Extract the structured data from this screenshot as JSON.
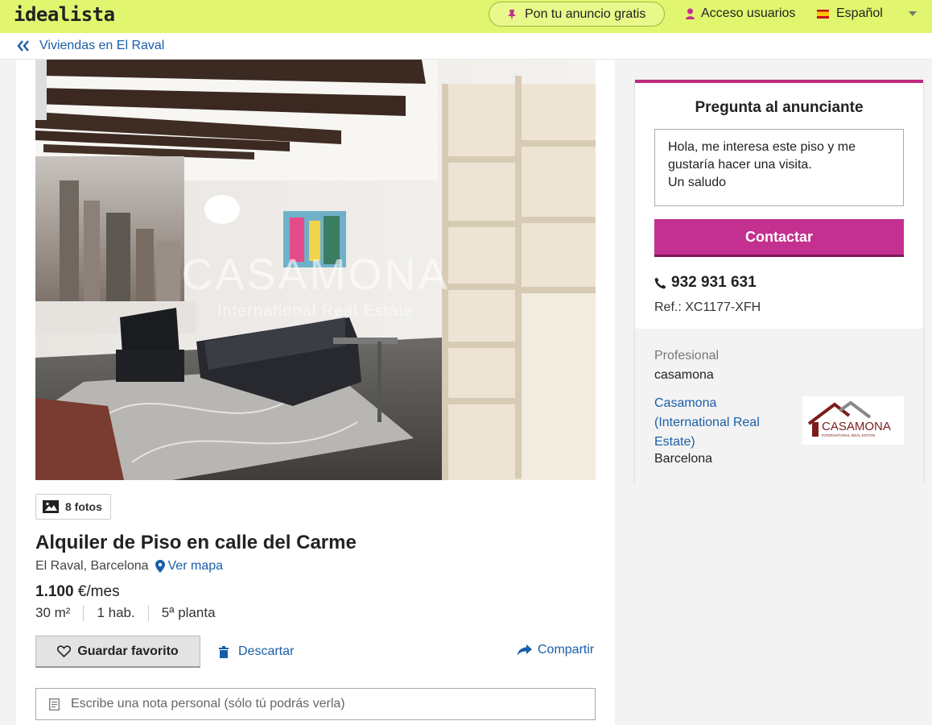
{
  "header": {
    "logo": "idealista",
    "post_ad": "Pon tu anuncio gratis",
    "login": "Acceso usuarios",
    "language": "Español"
  },
  "breadcrumb": {
    "label": "Viviendas en El Raval"
  },
  "listing": {
    "photos_button": "8 fotos",
    "watermark_line1": "CASAMONA",
    "watermark_line2": "International Real Estate",
    "title": "Alquiler de Piso en calle del Carme",
    "location": "El Raval, Barcelona",
    "map_link": "Ver mapa",
    "price_amount": "1.100",
    "price_unit": "€/mes",
    "features": [
      "30 m²",
      "1 hab.",
      "5ª planta"
    ],
    "favorite_button": "Guardar favorito",
    "discard_link": "Descartar",
    "share_link": "Compartir",
    "note_placeholder": "Escribe una nota personal (sólo tú podrás verla)"
  },
  "contact": {
    "heading": "Pregunta al anunciante",
    "message": "Hola, me interesa este piso y me\ngustaría hacer una visita.\nUn saludo",
    "button": "Contactar",
    "phone": "932 931 631",
    "reference": "Ref.: XC1177-XFH",
    "professional_label": "Profesional",
    "professional_name": "casamona",
    "agency_name": "Casamona (International Real Estate)",
    "agency_city": "Barcelona",
    "agency_logo_text": "CASAMONA",
    "agency_logo_subtext": "INTERNATIONAL REAL ESTATE"
  },
  "colors": {
    "header_bg": "#e1f56e",
    "link_blue": "#1a5ea8",
    "accent_magenta": "#c43090",
    "logo_red": "#8b1a1a"
  },
  "icons": [
    "pin-icon",
    "user-icon",
    "flag-spain-icon",
    "chevron-down-icon",
    "double-chevron-left-icon",
    "camera-icon",
    "map-pin-icon",
    "heart-icon",
    "trash-icon",
    "share-icon",
    "note-icon",
    "phone-icon"
  ]
}
